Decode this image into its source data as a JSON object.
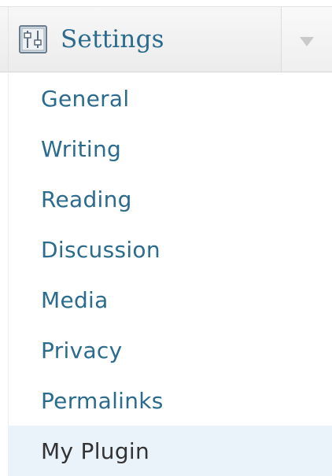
{
  "menu": {
    "title": "Settings",
    "icon": "settings-sliders-icon",
    "toggle_icon": "chevron-down-icon",
    "items": [
      {
        "label": "General",
        "current": false
      },
      {
        "label": "Writing",
        "current": false
      },
      {
        "label": "Reading",
        "current": false
      },
      {
        "label": "Discussion",
        "current": false
      },
      {
        "label": "Media",
        "current": false
      },
      {
        "label": "Privacy",
        "current": false
      },
      {
        "label": "Permalinks",
        "current": false
      },
      {
        "label": "My Plugin",
        "current": true
      }
    ]
  },
  "colors": {
    "link": "#2a6b8e",
    "current_bg": "#eaf2fa",
    "current_text": "#333333",
    "header_bg": "#f0f0f0"
  }
}
